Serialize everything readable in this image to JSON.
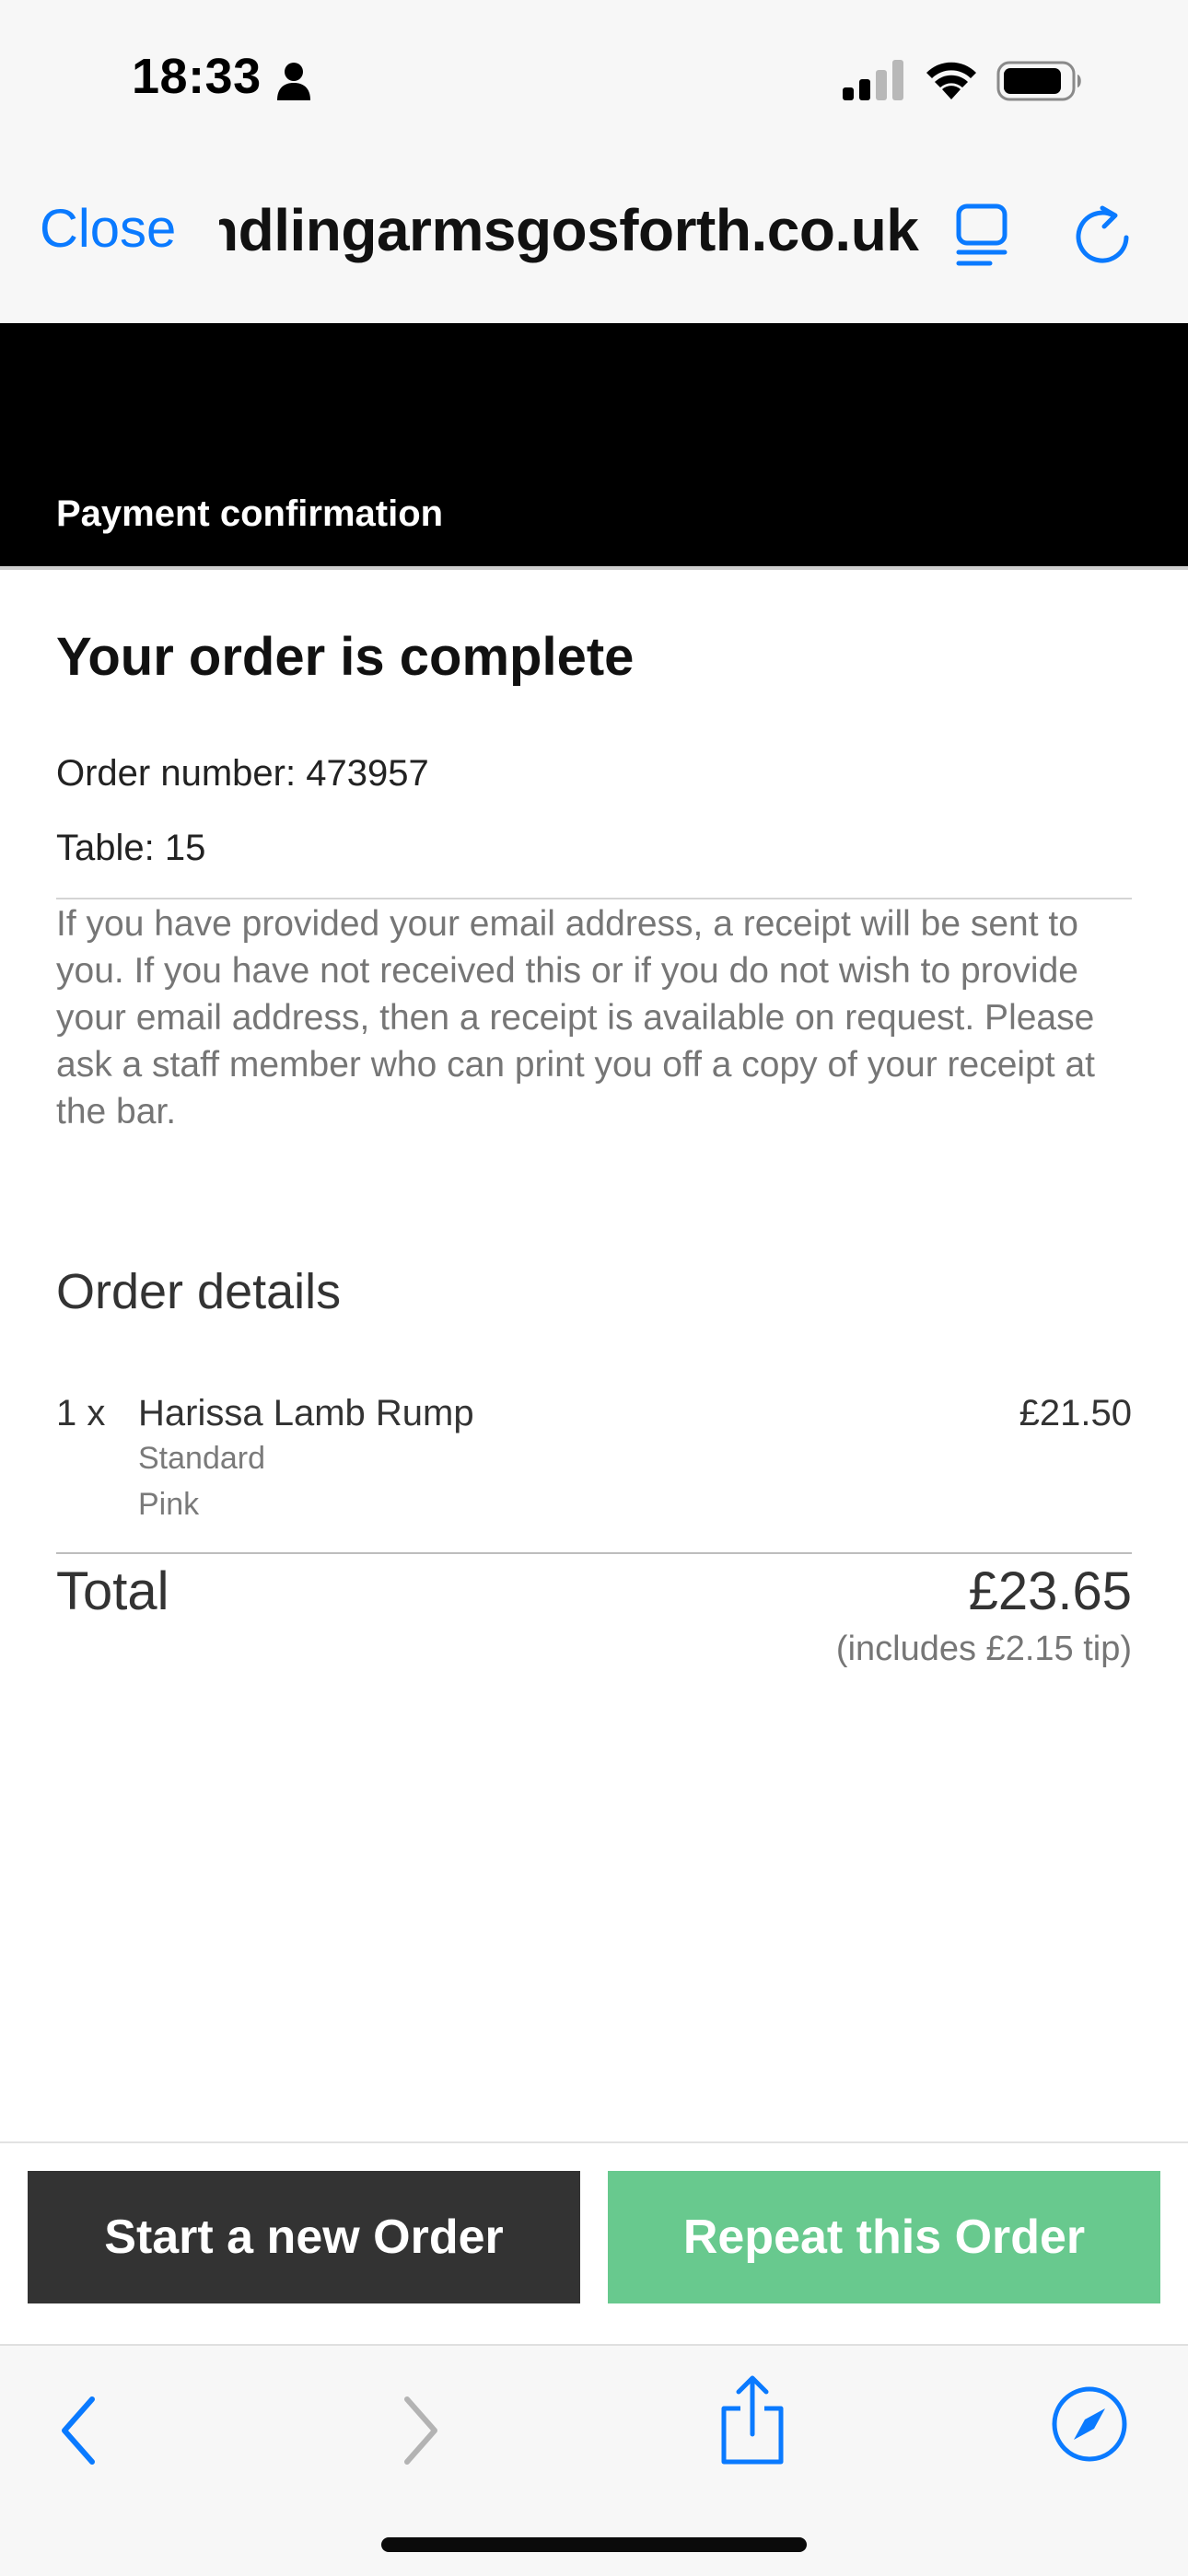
{
  "status_bar": {
    "time": "18:33"
  },
  "browser": {
    "close_label": "Close",
    "url": "ndlingarmsgosforth.co.uk"
  },
  "header": {
    "title": "Payment confirmation"
  },
  "confirmation": {
    "heading": "Your order is complete",
    "order_number": "Order number: 473957",
    "table": "Table: 15",
    "note": "If you have provided your email address, a receipt will be sent to you. If you have not received this or if you do not wish to provide your email address, then a receipt is available on request. Please ask a staff member who can print you off a copy of your receipt at the bar."
  },
  "order_details": {
    "heading": "Order details",
    "items": [
      {
        "qty": "1 x",
        "name": "Harissa Lamb Rump",
        "options": [
          "Standard",
          "Pink"
        ],
        "price": "£21.50"
      }
    ],
    "total_label": "Total",
    "total_value": "£23.65",
    "tip_note": "(includes £2.15 tip)"
  },
  "actions": {
    "new_order": "Start a new Order",
    "repeat_order": "Repeat this Order"
  },
  "colors": {
    "accent": "#0a7aff",
    "repeat_button": "#68c98e",
    "new_button": "#333333",
    "header_bg": "#000000"
  },
  "icons": {
    "person": "person-icon",
    "signal": "signal-icon",
    "wifi": "wifi-icon",
    "battery": "battery-icon",
    "reader": "reader-icon",
    "reload": "reload-icon",
    "back": "back-icon",
    "forward": "forward-icon",
    "share": "share-icon",
    "safari": "compass-icon"
  }
}
